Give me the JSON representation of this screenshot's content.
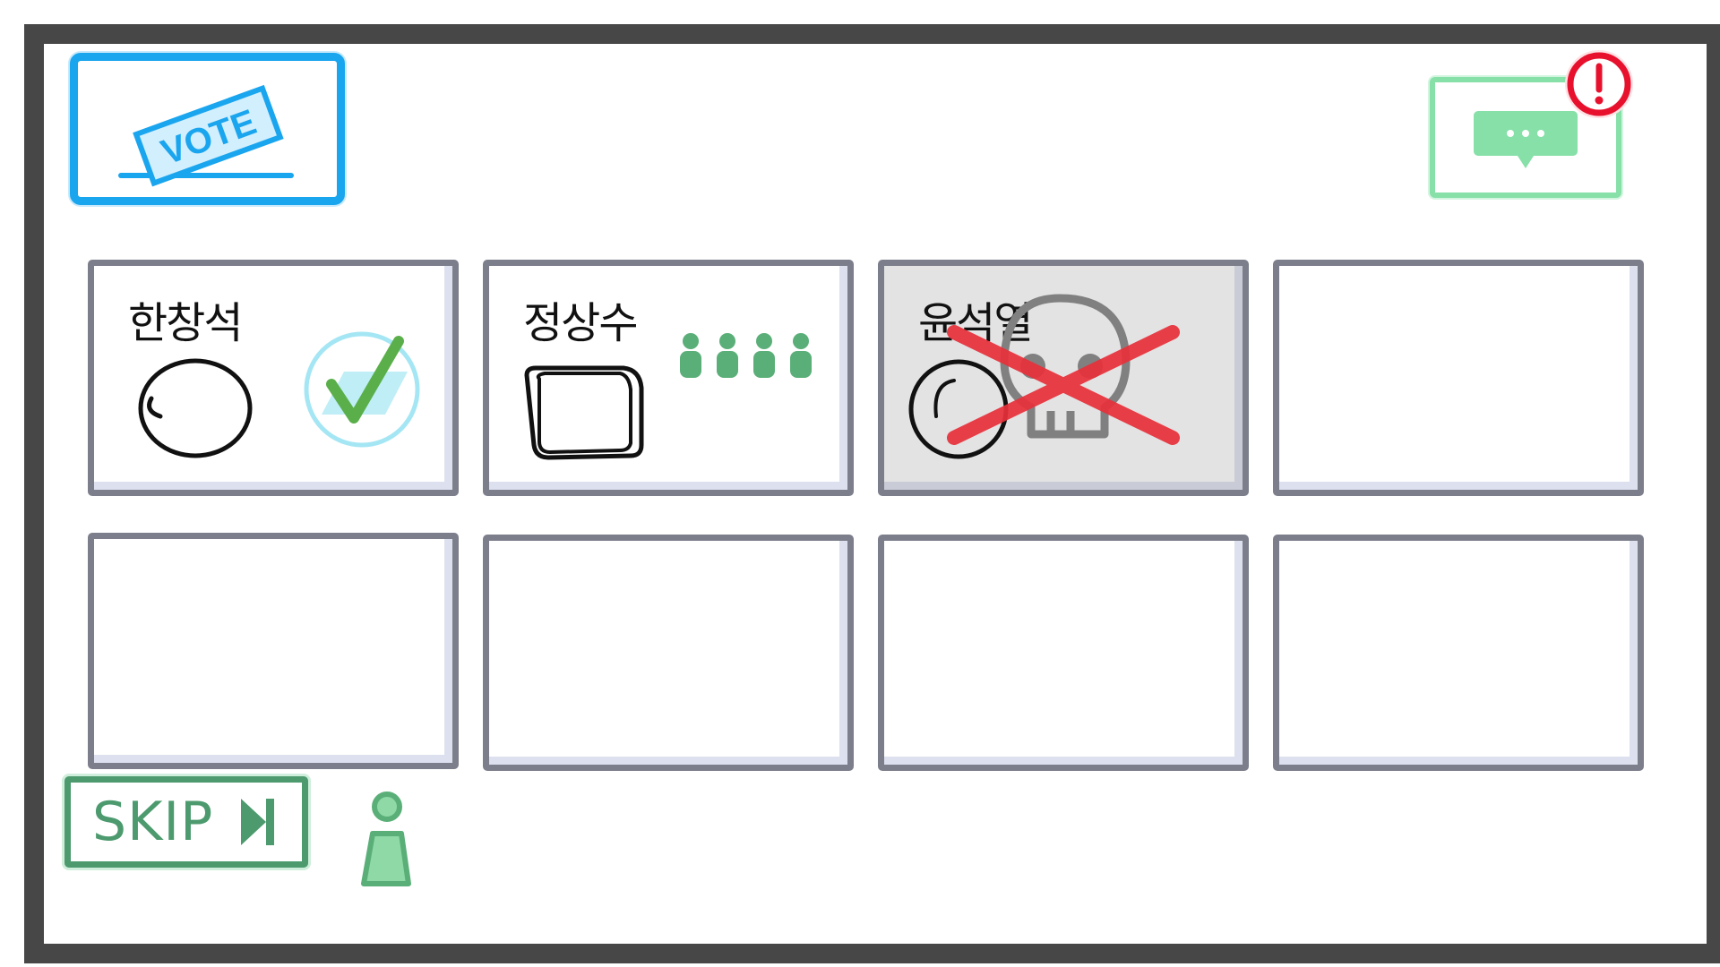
{
  "vote_button": {
    "label": "VOTE",
    "icon": "ballot-box-icon",
    "color": "#1aa5ef"
  },
  "chat_button": {
    "icon": "chat-bubble-icon",
    "color": "#86e0a8",
    "alert_icon": "exclamation-alert-icon",
    "alert_color": "#e8112d"
  },
  "players": [
    {
      "name": "한창석",
      "status": "voted",
      "votes_received": 0,
      "icon": "vote-check-icon"
    },
    {
      "name": "정상수",
      "status": "alive",
      "votes_received": 4,
      "icon": "voter-person-icon"
    },
    {
      "name": "윤석열",
      "status": "dead",
      "votes_received": 0,
      "icon": "skull-icon"
    },
    {
      "name": "",
      "status": "empty"
    },
    {
      "name": "",
      "status": "empty"
    },
    {
      "name": "",
      "status": "empty"
    },
    {
      "name": "",
      "status": "empty"
    },
    {
      "name": "",
      "status": "empty"
    }
  ],
  "skip": {
    "label": "SKIP",
    "votes": 1,
    "icon": "skip-forward-icon"
  },
  "colors": {
    "voter": "#5aaf78",
    "voter_light": "#8ed9a6",
    "dead_cross": "#e8303a",
    "frame": "#474747"
  }
}
